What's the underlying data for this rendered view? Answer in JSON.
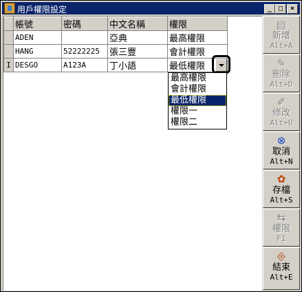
{
  "window": {
    "title": "用戶權限設定",
    "icon": "app-icon",
    "controls": [
      "minimize",
      "maximize",
      "close"
    ]
  },
  "grid": {
    "columns": [
      "帳號",
      "密碼",
      "中文名稱",
      "權限"
    ],
    "rows": [
      {
        "indicator": "",
        "account": "ADEN",
        "password": "",
        "name": "亞典",
        "permission": "最高權限"
      },
      {
        "indicator": "",
        "account": "HANG",
        "password": "52222225",
        "name": "張三豐",
        "permission": "會計權限"
      },
      {
        "indicator": "I",
        "account": "DESGO",
        "password": "A123A",
        "name": "丁小語",
        "permission": "最低權限"
      }
    ]
  },
  "dropdown": {
    "options": [
      "最高權限",
      "會計權限",
      "最低權限",
      "權限一",
      "權限二"
    ],
    "selected_index": 2
  },
  "toolbar": {
    "buttons": [
      {
        "icon": "new-icon",
        "label": "新增",
        "shortcut": "Alt+A",
        "enabled": false
      },
      {
        "icon": "delete-icon",
        "label": "刪除",
        "shortcut": "Alt+D",
        "enabled": false
      },
      {
        "icon": "edit-icon",
        "label": "修改",
        "shortcut": "Alt+U",
        "enabled": false
      },
      {
        "icon": "cancel-icon",
        "label": "取消",
        "shortcut": "Alt+N",
        "enabled": true
      },
      {
        "icon": "save-icon",
        "label": "存檔",
        "shortcut": "Alt+S",
        "enabled": true
      },
      {
        "icon": "permission-icon",
        "label": "權限",
        "shortcut": "F1",
        "enabled": false
      },
      {
        "icon": "exit-icon",
        "label": "結束",
        "shortcut": "Alt+E",
        "enabled": true
      }
    ]
  },
  "colors": {
    "titlebar": "#0a246a",
    "selection": "#0a246a",
    "face": "#d4d0c8"
  }
}
